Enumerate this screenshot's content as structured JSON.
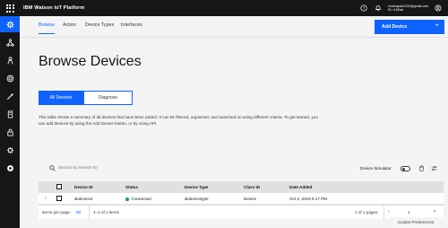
{
  "topbar": {
    "title": "IBM Watson IoT Platform",
    "user_email": "moetrapati1234@gmail.com",
    "org_id": "ID: r152ws",
    "icons": [
      "waffle-menu-icon",
      "help-icon",
      "notification-icon",
      "user-avatar-icon"
    ]
  },
  "sidebar": {
    "items": [
      {
        "name": "devices",
        "icon": "gear-icon",
        "active": true
      },
      {
        "name": "apps",
        "icon": "network-icon",
        "active": false
      },
      {
        "name": "members",
        "icon": "person-icon",
        "active": false
      },
      {
        "name": "security",
        "icon": "shield-icon",
        "active": false
      },
      {
        "name": "rules",
        "icon": "wand-icon",
        "active": false
      },
      {
        "name": "extensions",
        "icon": "card-icon",
        "active": false
      },
      {
        "name": "lock",
        "icon": "lock-icon",
        "active": false
      },
      {
        "name": "settings",
        "icon": "cog-icon",
        "active": false
      },
      {
        "name": "dashboard",
        "icon": "circle-icon",
        "active": false
      }
    ]
  },
  "subnav": {
    "tabs": [
      {
        "label": "Browse",
        "active": true
      },
      {
        "label": "Action",
        "active": false
      },
      {
        "label": "Device Types",
        "active": false
      },
      {
        "label": "Interfaces",
        "active": false
      }
    ],
    "add_button": "Add Device",
    "add_button_icon": "+"
  },
  "page": {
    "title": "Browse Devices",
    "segments": [
      {
        "label": "All Devices",
        "active": true
      },
      {
        "label": "Diagnose",
        "active": false
      }
    ],
    "description": "This table shows a summary of all devices that have been added. It can be filtered, organized, and searched on using different criteria. To get started, you can add devices by using the Add Device button, or by using API."
  },
  "table": {
    "search_placeholder": "Search by Device ID",
    "simulator_label": "Device Simulator",
    "simulator_on": false,
    "columns": [
      "Device ID",
      "Status",
      "Device Type",
      "Class ID",
      "Date Added"
    ],
    "rows": [
      {
        "device_id": "skdevice4",
        "status": "Connected",
        "device_type": "skdevicetype",
        "class_id": "Device",
        "date_added": "Oct 3, 2019 5:17 PM"
      }
    ],
    "pagination": {
      "items_per_page_label": "Items per page:",
      "items_per_page_value": "50",
      "range": "1–1 of 1 items",
      "pages_text": "1 of 1 pages",
      "current_page": "1"
    }
  },
  "footer": {
    "cookie_label": "Cookie Preferences"
  },
  "colors": {
    "accent": "#0f62fe",
    "topbar": "#161616",
    "status_connected": "#24a148"
  }
}
